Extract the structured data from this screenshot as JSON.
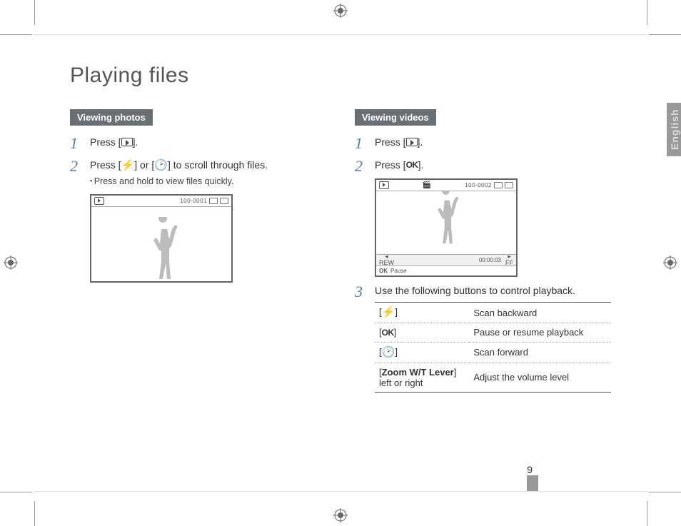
{
  "page_title": "Playing files",
  "language_tab": "English",
  "page_number": "9",
  "left": {
    "heading": "Viewing photos",
    "steps": [
      {
        "num": "1",
        "text_pre": "Press [",
        "text_post": "]."
      },
      {
        "num": "2",
        "text_pre": "Press [",
        "text_mid": "] or [",
        "text_post": "] to scroll through files.",
        "sub": "Press and hold to view files quickly."
      }
    ],
    "screenshot": {
      "counter": "100-0001"
    }
  },
  "right": {
    "heading": "Viewing videos",
    "steps": [
      {
        "num": "1",
        "text_pre": "Press [",
        "text_post": "]."
      },
      {
        "num": "2",
        "text_pre": "Press [",
        "text_post": "]."
      },
      {
        "num": "3",
        "text": "Use the following buttons to control playback."
      }
    ],
    "screenshot": {
      "counter": "100-0002",
      "rew": "REW",
      "ff": "FF",
      "time": "00:00:03",
      "ok": "OK",
      "pause": "Pause"
    },
    "table": [
      {
        "key_pre": "[",
        "key_icon": "flash",
        "key_post": "]",
        "val": "Scan backward"
      },
      {
        "key_pre": "[",
        "key_icon": "ok",
        "key_post": "]",
        "val": "Pause or resume playback"
      },
      {
        "key_pre": "[",
        "key_icon": "timer",
        "key_post": "]",
        "val": "Scan forward"
      },
      {
        "key_text_pre": "[",
        "key_bold": "Zoom W/T Lever",
        "key_text_post": "] left or right",
        "val": "Adjust the volume level"
      }
    ]
  }
}
